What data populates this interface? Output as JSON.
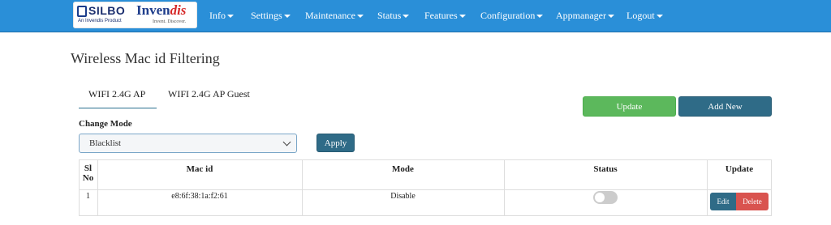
{
  "brand": {
    "silbo": "SILBO",
    "silbo_tagline": "An Invendis Product",
    "invendis_main": "Inven",
    "invendis_accent": "dis",
    "invendis_tagline": "Invent. Discover."
  },
  "nav": {
    "items": [
      {
        "label": "Info"
      },
      {
        "label": "Settings"
      },
      {
        "label": "Maintenance"
      },
      {
        "label": "Status"
      },
      {
        "label": "Features"
      },
      {
        "label": "Configuration"
      },
      {
        "label": "Appmanager"
      },
      {
        "label": "Logout"
      }
    ]
  },
  "page": {
    "title": "Wireless Mac id Filtering"
  },
  "tabs": [
    {
      "label": "WIFI 2.4G AP",
      "active": true
    },
    {
      "label": "WIFI 2.4G AP Guest",
      "active": false
    }
  ],
  "actions": {
    "update_label": "Update",
    "add_new_label": "Add New"
  },
  "mode": {
    "label": "Change Mode",
    "selected": "Blacklist",
    "apply_label": "Apply"
  },
  "table": {
    "headers": {
      "sl_line1": "Sl",
      "sl_line2": "No",
      "mac": "Mac id",
      "mode": "Mode",
      "status": "Status",
      "update": "Update"
    },
    "rows": [
      {
        "sl": "1",
        "mac": "e8:6f:38:1a:f2:61",
        "mode": "Disable",
        "status_on": false,
        "edit_label": "Edit",
        "delete_label": "Delete"
      }
    ]
  },
  "colors": {
    "navbar": "#2a8fd8",
    "primary_dark": "#2f6b87",
    "success": "#5cb85c",
    "danger": "#d9534f"
  }
}
